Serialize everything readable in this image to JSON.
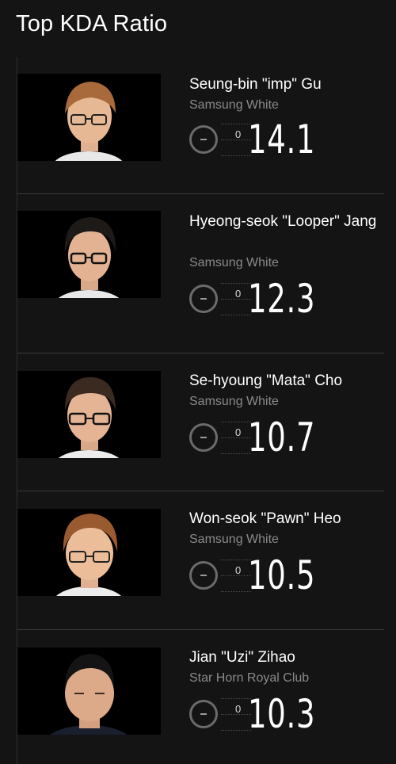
{
  "title": "Top KDA Ratio",
  "players": [
    {
      "name": "Seung-bin \"imp\" Gu",
      "team": "Samsung White",
      "counter": "0",
      "kda": "14.1",
      "hair": "#a86a3a"
    },
    {
      "name": "Hyeong-seok \"Looper\" Jang",
      "team": "Samsung White",
      "counter": "0",
      "kda": "12.3",
      "hair": "#1e1a17"
    },
    {
      "name": "Se-hyoung \"Mata\" Cho",
      "team": "Samsung White",
      "counter": "0",
      "kda": "10.7",
      "hair": "#3b2a20"
    },
    {
      "name": "Won-seok \"Pawn\" Heo",
      "team": "Samsung White",
      "counter": "0",
      "kda": "10.5",
      "hair": "#9a5a30"
    },
    {
      "name": "Jian \"Uzi\" Zihao",
      "team": "Star Horn Royal Club",
      "counter": "0",
      "kda": "10.3",
      "hair": "#141414"
    }
  ]
}
